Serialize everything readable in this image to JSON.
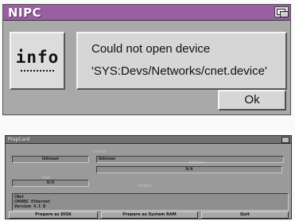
{
  "requester": {
    "title": "NIPC",
    "icon_label": "info",
    "message_line1": "Could not open device",
    "message_line2": "'SYS:Devs/Networks/cnet.device'",
    "ok_label": "Ok"
  },
  "prepcard": {
    "title": "PrepCard",
    "device_label": "Device",
    "left_value": "Unknown",
    "right_value": "Unknown",
    "address_label": "Address",
    "address_value": "N/A",
    "unit_label": "Unit",
    "unit_value": "N/A",
    "status_label": "Status",
    "info_lines": [
      "CNet",
      "CM400C Ethernet",
      "Version 4.1  B"
    ],
    "buttons": {
      "disk": "Prepare as DISK",
      "ram": "Prepare as System RAM",
      "quit": "Quit"
    }
  }
}
